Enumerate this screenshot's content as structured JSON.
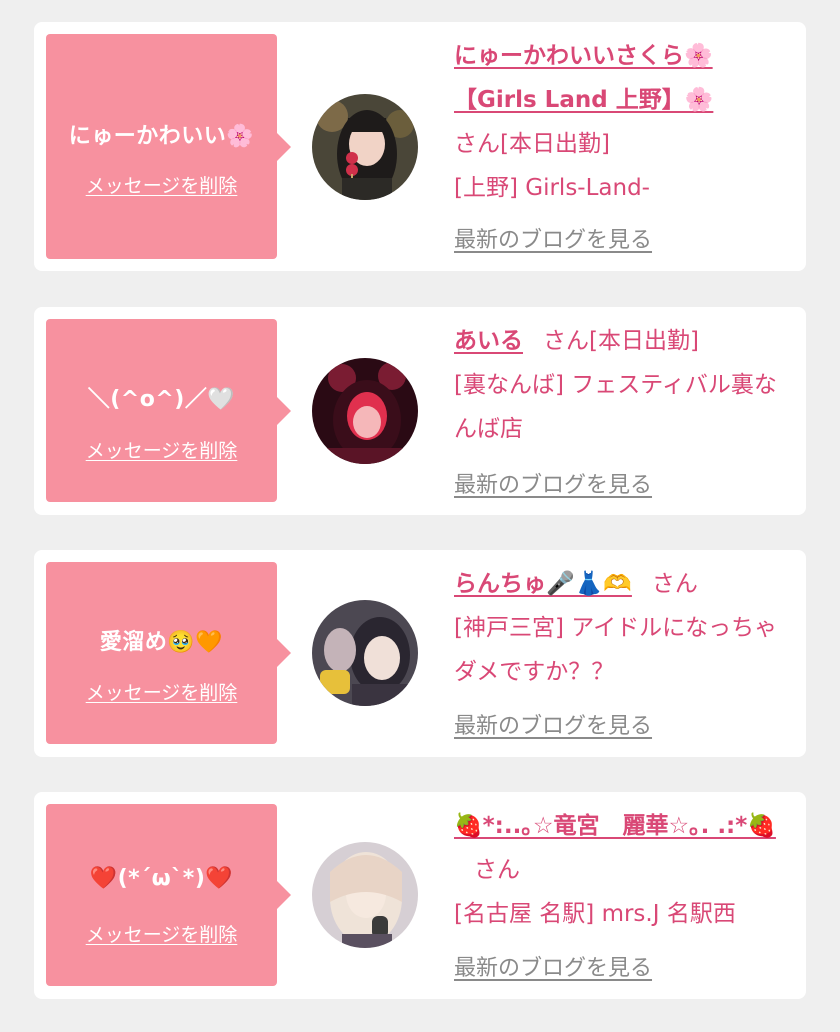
{
  "cards": [
    {
      "bubble_message": "にゅーかわいい🌸",
      "delete_label": "メッセージを削除",
      "name": "にゅーかわいいさくら🌸【Girls Land 上野】🌸",
      "san": "さん",
      "status": "[本日出勤]",
      "shop": "[上野] Girls-Land-",
      "blog_label": "最新のブログを見る",
      "avatar_colors": [
        "#2c2a26",
        "#d07a6a",
        "#f1d3c6"
      ]
    },
    {
      "bubble_message": "＼(^o^)／🤍",
      "delete_label": "メッセージを削除",
      "name": "あいる",
      "san": "さん",
      "status": "[本日出勤]",
      "shop": "[裏なんば] フェスティバル裏なんば店",
      "blog_label": "最新のブログを見る",
      "avatar_colors": [
        "#3a0d1a",
        "#e0304e",
        "#f5b7b9"
      ]
    },
    {
      "bubble_message": "愛溜め🥹🧡",
      "delete_label": "メッセージを削除",
      "name": "らんちゅ🎤👗🫶",
      "san": "さん",
      "status": "",
      "shop": "[神戸三宮] アイドルになっちゃダメですか？？",
      "blog_label": "最新のブログを見る",
      "avatar_colors": [
        "#5a5660",
        "#c4b3b8",
        "#f0e0d8"
      ]
    },
    {
      "bubble_message": "❤️(*´ω`*)❤️",
      "delete_label": "メッセージを削除",
      "name": "🍓*:..｡☆竜宮　麗華☆｡. .:*🍓",
      "san": "さん",
      "status": "",
      "shop": "[名古屋 名駅] mrs.J 名駅西",
      "blog_label": "最新のブログを見る",
      "avatar_colors": [
        "#c9c1c7",
        "#e8d4c6",
        "#f6e9df"
      ]
    }
  ]
}
